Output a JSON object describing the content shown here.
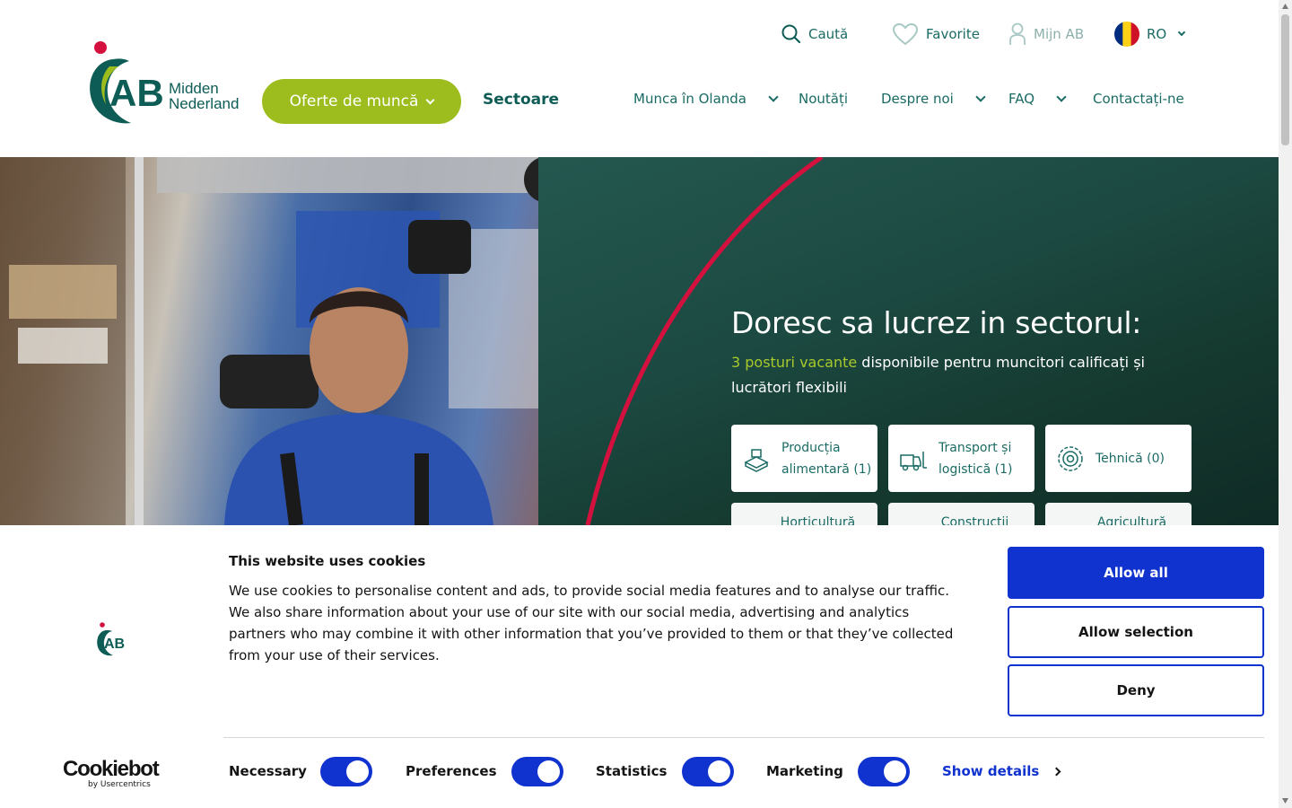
{
  "brand": {
    "logo_letters": "AB",
    "logo_line1": "Midden",
    "logo_line2": "Nederland",
    "accent_green": "#9dbd1e",
    "dark_teal": "#0d5c55",
    "red": "#d4113e"
  },
  "topbar": {
    "search": "Caută",
    "favorites": "Favorite",
    "account": "Mijn AB",
    "language": "RO"
  },
  "nav": {
    "jobs_button": "Oferte de muncă",
    "sectors": "Sectoare",
    "items": [
      {
        "label": "Munca în Olanda",
        "dropdown": true
      },
      {
        "label": "Noutăți",
        "dropdown": false
      },
      {
        "label": "Despre noi",
        "dropdown": true
      },
      {
        "label": "FAQ",
        "dropdown": true
      },
      {
        "label": "Contactați-ne",
        "dropdown": false
      }
    ]
  },
  "hero": {
    "title": "Doresc sa lucrez in sectorul:",
    "highlight": "3 posturi vacante",
    "subtitle": " disponibile pentru muncitori calificați și lucrători flexibili",
    "cards": [
      {
        "line1": "Producția",
        "line2": "alimentară (1)",
        "icon": "food-production-icon"
      },
      {
        "line1": "Transport și",
        "line2": "logistică (1)",
        "icon": "forklift-icon"
      },
      {
        "line1": "Tehnică (0)",
        "line2": "",
        "icon": "gear-icon"
      }
    ],
    "cards_row2": [
      "Horticultură",
      "Construcții",
      "Agricultură"
    ]
  },
  "cookie": {
    "title": "This website uses cookies",
    "body": "We use cookies to personalise content and ads, to provide social media features and to analyse our traffic. We also share information about your use of our site with our social media, advertising and analytics partners who may combine it with other information that you’ve provided to them or that they’ve collected from your use of their services.",
    "allow_all": "Allow all",
    "allow_selection": "Allow selection",
    "deny": "Deny",
    "toggles": [
      {
        "label": "Necessary",
        "on": true
      },
      {
        "label": "Preferences",
        "on": true
      },
      {
        "label": "Statistics",
        "on": true
      },
      {
        "label": "Marketing",
        "on": true
      }
    ],
    "show_details": "Show details",
    "cookiebot_main": "Cookiebot",
    "cookiebot_sub": "by Usercentrics",
    "primary_color": "#1032cf"
  }
}
